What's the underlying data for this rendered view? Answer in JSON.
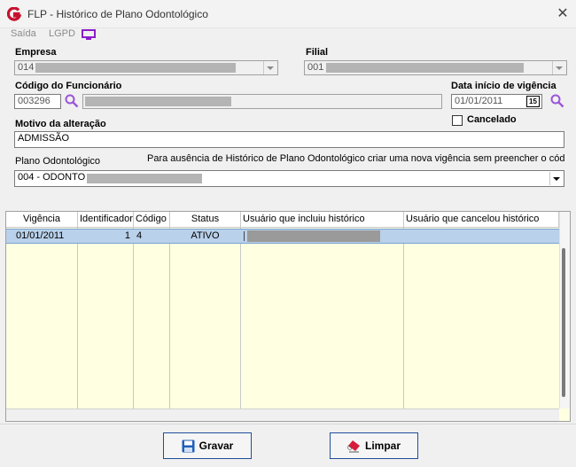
{
  "window": {
    "title": "FLP - Histórico de Plano Odontológico",
    "close_glyph": "✕"
  },
  "menu": {
    "items": [
      "Saída",
      "LGPD"
    ],
    "monitor_icon": "monitor-icon"
  },
  "form": {
    "empresa": {
      "label": "Empresa",
      "value": "014"
    },
    "filial": {
      "label": "Filial",
      "value": "001"
    },
    "codigo_funcionario": {
      "label": "Código do Funcionário",
      "value": "003296"
    },
    "data_inicio": {
      "label": "Data início de vigência",
      "value": "01/01/2011",
      "calendar_glyph": "15"
    },
    "cancelado": {
      "label": "Cancelado",
      "checked": false
    },
    "motivo": {
      "label": "Motivo da alteração",
      "value": "ADMISSÃO"
    },
    "plano": {
      "label": "Plano Odontológico",
      "hint": "Para ausência de Histórico de Plano Odontológico criar uma nova vigência sem preencher o código",
      "value": "004 - ODONTO"
    }
  },
  "grid": {
    "columns": [
      "Vigência",
      "Identificador",
      "Código",
      "Status",
      "Usuário que incluiu histórico",
      "Usuário que cancelou histórico"
    ],
    "rows": [
      {
        "vigencia": "01/01/2011",
        "identificador": "1",
        "codigo": "4",
        "status": "ATIVO",
        "usuario_incluiu": "",
        "usuario_cancelou": ""
      }
    ]
  },
  "buttons": {
    "gravar": "Gravar",
    "limpar": "Limpar"
  },
  "colors": {
    "accent": "#1e4f9a",
    "grid_bg": "#ffffe1",
    "selected_row": "#b9d1ea",
    "logo_red": "#c8102e",
    "lgpd_purple": "#8a1ec8"
  }
}
